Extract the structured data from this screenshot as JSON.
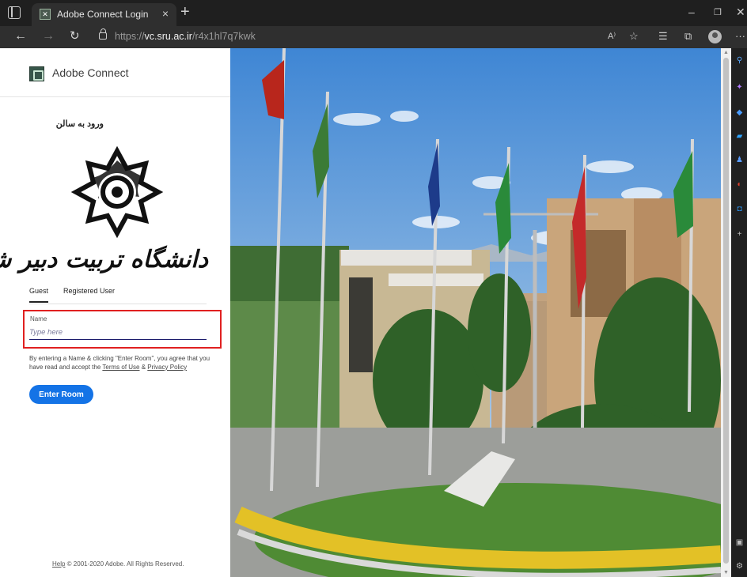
{
  "browser": {
    "tab": {
      "title": "Adobe Connect Login",
      "close": "×"
    },
    "new_tab": "+",
    "window_controls": {
      "minimize": "–",
      "restore": "❐",
      "close": "✕"
    },
    "url": {
      "scheme": "https://",
      "host": "vc.sru.ac.ir",
      "path": "/r4x1hl7q7kwk"
    },
    "toolbar_icons": [
      "read-aloud-icon",
      "add-favorite-icon",
      "favorites-icon",
      "collections-icon",
      "profile-icon",
      "more-icon"
    ],
    "more": "···"
  },
  "brand": {
    "name": "Adobe Connect"
  },
  "room": {
    "title": "ورود به سالن"
  },
  "university": {
    "name": "دانشگاه تربیت دبیر شهید رجائی"
  },
  "login": {
    "tabs": [
      {
        "label": "Guest",
        "active": true
      },
      {
        "label": "Registered User",
        "active": false
      }
    ],
    "name_label": "Name",
    "name_placeholder": "Type here",
    "name_value": "",
    "consent_prefix": "By entering a Name & clicking \"Enter Room\", you agree that you have read and accept the ",
    "terms_link": "Terms of Use",
    "consent_and": " & ",
    "privacy_link": "Privacy Policy",
    "enter_button": "Enter Room"
  },
  "footer": {
    "help_link": "Help",
    "copyright": " © 2001-2020 Adobe. All Rights Reserved."
  },
  "colors": {
    "accent": "#1473e6",
    "highlight": "#e02020",
    "brand_green": "#37564a"
  }
}
